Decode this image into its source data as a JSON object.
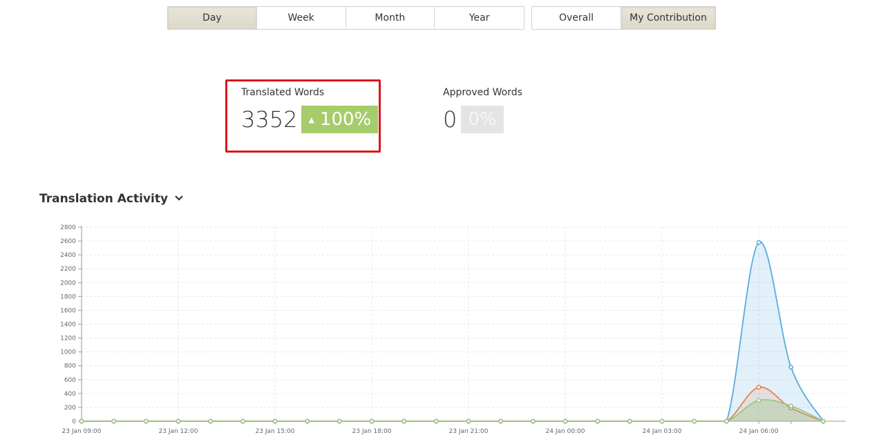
{
  "period_tabs": [
    {
      "label": "Day",
      "active": true
    },
    {
      "label": "Week",
      "active": false
    },
    {
      "label": "Month",
      "active": false
    },
    {
      "label": "Year",
      "active": false
    }
  ],
  "scope_tabs": [
    {
      "label": "Overall",
      "active": false
    },
    {
      "label": "My Contribution",
      "active": true
    }
  ],
  "stats": {
    "translated": {
      "label": "Translated Words",
      "value": "3352",
      "change": "100%",
      "trend": "up"
    },
    "approved": {
      "label": "Approved Words",
      "value": "0",
      "change": "0%"
    }
  },
  "activity": {
    "title": "Translation Activity",
    "dropdown_icon": "chevron-down-icon"
  },
  "colors": {
    "accent_active": "#dcd8ca",
    "badge_up": "#a6cc6b",
    "badge_neutral": "#e4e4e4",
    "highlight_border": "#d9161c",
    "series_blue": "#5aabdc",
    "series_orange": "#ee7f4a",
    "series_green": "#9cc48a"
  },
  "chart_data": {
    "type": "area",
    "x_tick_labels": [
      "23 Jan 09:00",
      "23 Jan 12:00",
      "23 Jan 15:00",
      "23 Jan 18:00",
      "23 Jan 21:00",
      "24 Jan 00:00",
      "24 Jan 03:00",
      "24 Jan 06:00"
    ],
    "x_range_hours": [
      0,
      23.7
    ],
    "ylim": [
      0,
      2800
    ],
    "y_ticks": [
      0,
      200,
      400,
      600,
      800,
      1000,
      1200,
      1400,
      1600,
      1800,
      2000,
      2200,
      2400,
      2600,
      2800
    ],
    "grid": true,
    "legend": "none",
    "x_hours": [
      0,
      1,
      2,
      3,
      4,
      5,
      6,
      7,
      8,
      9,
      10,
      11,
      12,
      13,
      14,
      15,
      16,
      17,
      18,
      19,
      20,
      21,
      22,
      23
    ],
    "series": [
      {
        "color": "#5aabdc",
        "fill": "rgba(90,171,220,0.18)",
        "values": [
          0,
          0,
          0,
          0,
          0,
          0,
          0,
          0,
          0,
          0,
          0,
          0,
          0,
          0,
          0,
          0,
          0,
          0,
          0,
          0,
          0,
          2580,
          780,
          0
        ]
      },
      {
        "color": "#ee7f4a",
        "fill": "rgba(238,127,74,0.15)",
        "values": [
          0,
          0,
          0,
          0,
          0,
          0,
          0,
          0,
          0,
          0,
          0,
          0,
          0,
          0,
          0,
          0,
          0,
          0,
          0,
          0,
          0,
          490,
          190,
          0
        ]
      },
      {
        "color": "#9cc48a",
        "fill": "rgba(156,196,138,0.35)",
        "values": [
          0,
          0,
          0,
          0,
          0,
          0,
          0,
          0,
          0,
          0,
          0,
          0,
          0,
          0,
          0,
          0,
          0,
          0,
          0,
          0,
          0,
          300,
          220,
          0
        ]
      }
    ]
  }
}
